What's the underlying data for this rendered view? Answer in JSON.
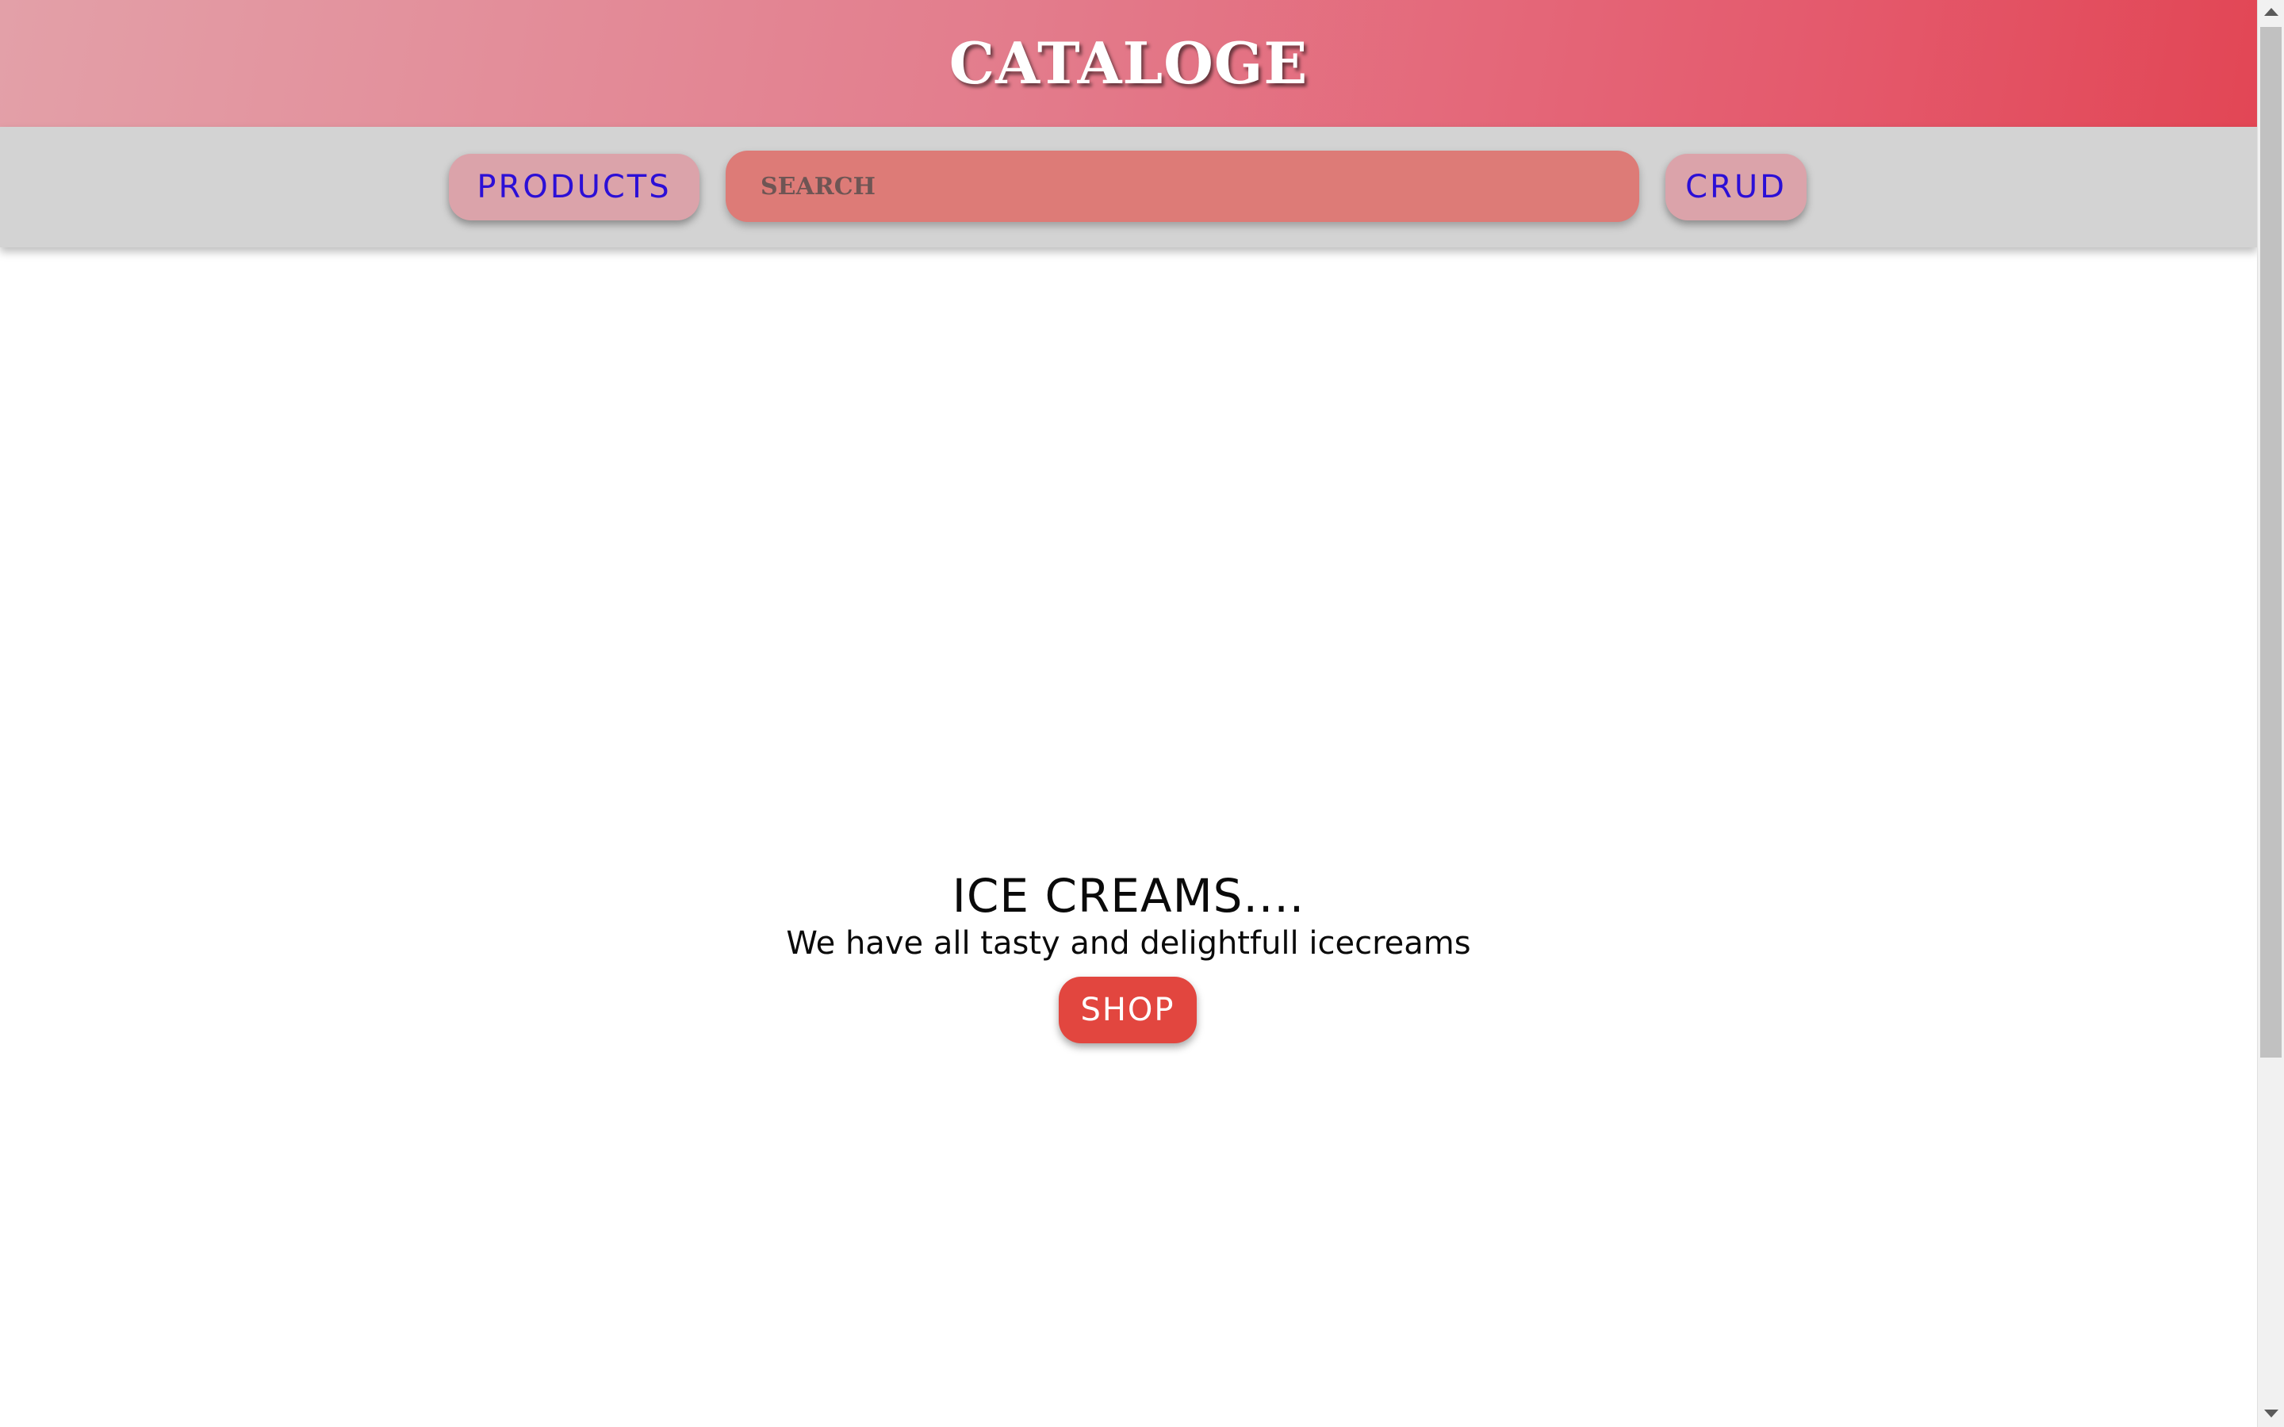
{
  "header": {
    "logo": "CATALOGE"
  },
  "nav": {
    "products_label": "PRODUCTS",
    "search_placeholder": "SEARCH",
    "search_value": "",
    "crud_label": "CRUD"
  },
  "hero": {
    "title": "ICE CREAMS....",
    "subtitle": "We have all tasty and delightfull icecreams",
    "shop_label": "SHOP"
  },
  "colors": {
    "header_gradient_start": "#e3a0a8",
    "header_gradient_end": "#e24655",
    "navbar_bg": "#d3d3d3",
    "nav_button_bg": "#dba3aa",
    "nav_button_text": "#2c0fd6",
    "search_bg": "#dd7b77",
    "shop_button_bg": "#e2463f"
  },
  "icons": {
    "scroll_up": "scroll-up-arrow-icon",
    "scroll_down": "scroll-down-arrow-icon"
  }
}
